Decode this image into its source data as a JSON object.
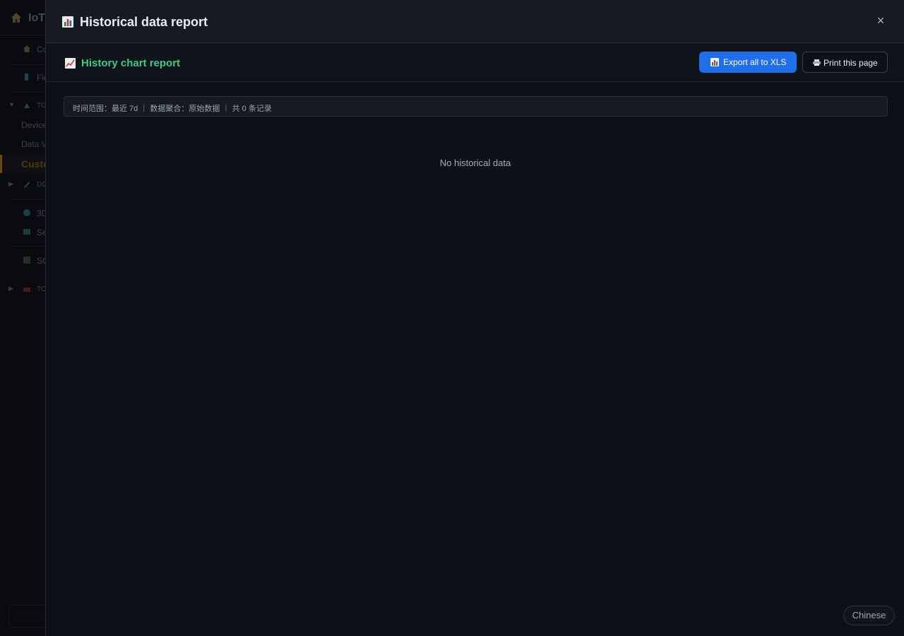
{
  "background_app": {
    "title": "IoT",
    "nav": [
      {
        "label": "Co",
        "icon": "home-icon"
      },
      {
        "label": "Fie",
        "icon": "phone-icon"
      },
      {
        "label": "TG",
        "icon": "antenna-icon",
        "group": true
      },
      {
        "label": "Device",
        "icon": ""
      },
      {
        "label": "Data V",
        "icon": ""
      },
      {
        "label": "Custo",
        "icon": "",
        "active": true
      },
      {
        "label": "DG",
        "icon": "pen-icon",
        "group": true
      },
      {
        "label": "3D",
        "icon": "globe-icon"
      },
      {
        "label": "Se",
        "icon": "book-icon"
      },
      {
        "label": "SC",
        "icon": "bar-chart-icon"
      },
      {
        "label": "TO",
        "icon": "toolbox-icon",
        "group": true
      }
    ],
    "active_color": "#a86d15"
  },
  "drawer": {
    "title": "Historical data report",
    "close_label": "×"
  },
  "toolbar": {
    "title": "History chart report",
    "title_color": "#3fc98b",
    "export_label": "Export all to XLS",
    "print_label": "Print this page",
    "accent_color": "#1f6feb"
  },
  "info": {
    "text": "时间范围：最近 7d ｜ 数据聚合：原始数据 ｜ 共 0 条记录"
  },
  "empty_state": {
    "message": "No historical data"
  },
  "language": {
    "label": "Chinese"
  }
}
